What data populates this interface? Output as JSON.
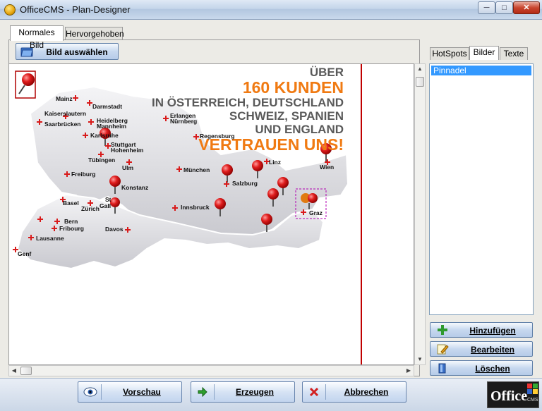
{
  "window": {
    "title": "OfficeCMS - Plan-Designer",
    "minimize": "─",
    "maximize": "□",
    "close": "✕"
  },
  "tabs": [
    {
      "label": "Normales Bild",
      "active": true
    },
    {
      "label": "Hervorgehoben",
      "active": false
    }
  ],
  "toolbar": {
    "select_image_label": "Bild auswählen"
  },
  "map": {
    "headline": {
      "line1": "ÜBER",
      "line2": "160 KUNDEN",
      "line3": "IN ÖSTERREICH, DEUTSCHLAND",
      "line4": "SCHWEIZ, SPANIEN",
      "line5": "UND ENGLAND",
      "line6": "VERTRAUEN UNS!"
    },
    "cities": {
      "mainz": "Mainz",
      "darmstadt": "Darmstadt",
      "kaiserslautern": "Kaiserslautern",
      "saarbruecken": "Saarbrücken",
      "heidelberg": "Heidelberg",
      "mannheim": "Mannheim",
      "erlangen": "Erlangen",
      "nuernberg": "Nürnberg",
      "karlsruhe": "Karlsruhe",
      "regensburg": "Regensburg",
      "stuttgart": "Stuttgart",
      "hohenheim": "Hohenheim",
      "tuebingen": "Tübingen",
      "ulm": "Ulm",
      "linz": "Linz",
      "wien": "Wien",
      "freiburg": "Freiburg",
      "muenchen": "München",
      "salzburg": "Salzburg",
      "konstanz": "Konstanz",
      "basel": "Basel",
      "zuerich": "Zürich",
      "stgallen_a": "St",
      "stgallen_b": "Gall",
      "innsbruck": "Innsbruck",
      "graz": "Graz",
      "bern": "Bern",
      "fribourg": "Fribourg",
      "davos": "Davos",
      "lausanne": "Lausanne",
      "genf": "Genf"
    }
  },
  "right_panel": {
    "tabs": [
      {
        "label": "HotSpots"
      },
      {
        "label": "Bilder",
        "active": true
      },
      {
        "label": "Texte"
      }
    ],
    "list_items": [
      "Pinnadel"
    ],
    "add_label": "Hinzufügen",
    "edit_label": "Bearbeiten",
    "delete_label": "Löschen"
  },
  "bottom": {
    "preview_label": "Vorschau",
    "generate_label": "Erzeugen",
    "cancel_label": "Abbrechen",
    "logo_text": "Office",
    "logo_sub": "CMS"
  },
  "colors": {
    "accent_orange": "#f07a12",
    "headline_gray": "#5a5a5a",
    "pin_red": "#d81b1b",
    "selection_blue": "#3399ff"
  }
}
